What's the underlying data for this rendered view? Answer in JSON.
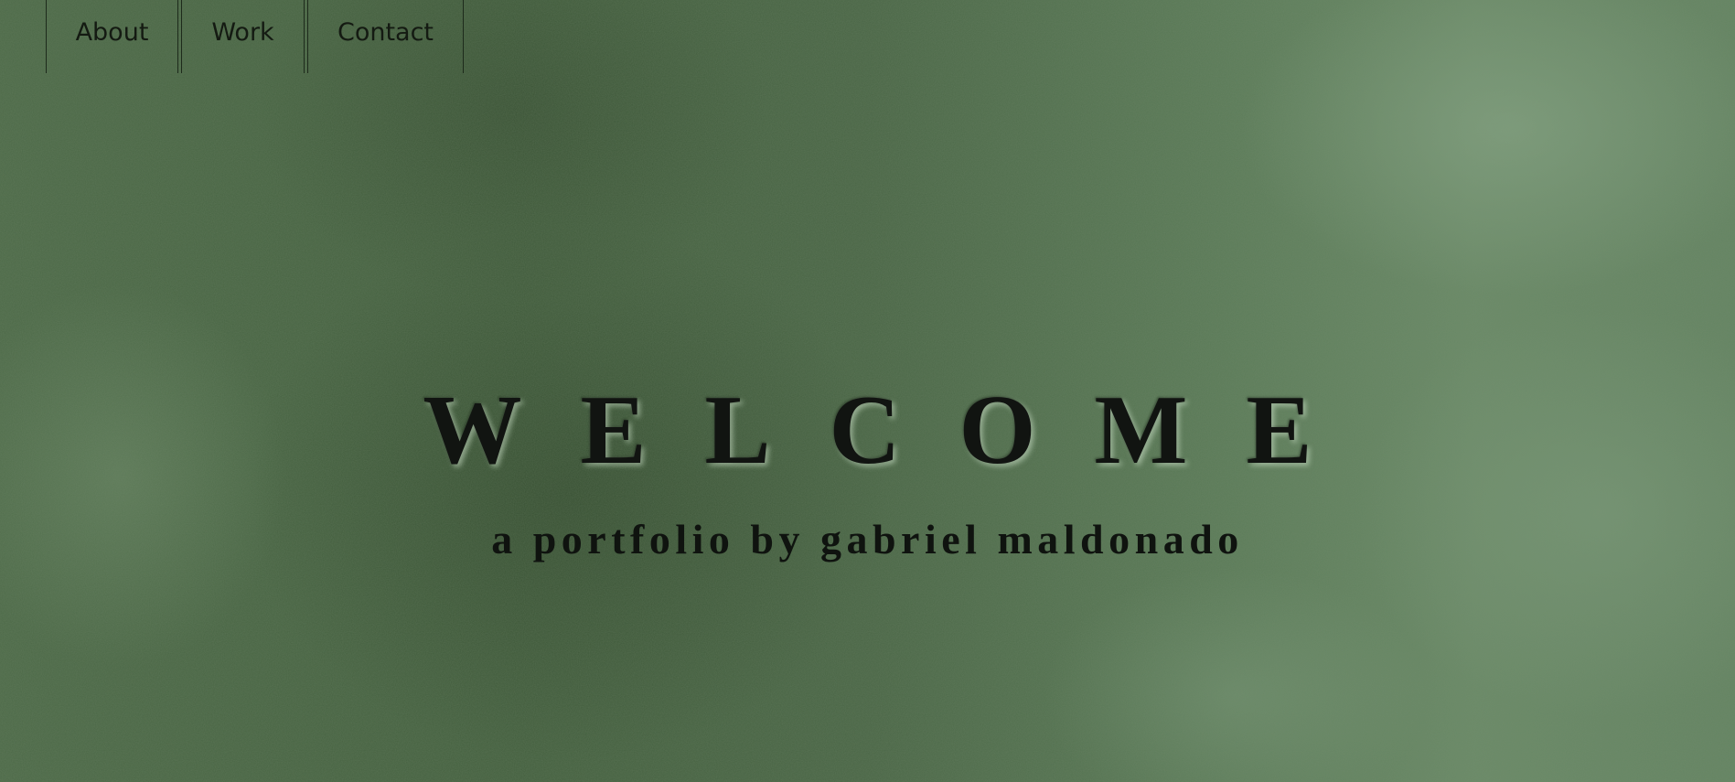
{
  "nav": {
    "items": [
      {
        "label": "About"
      },
      {
        "label": "Work"
      },
      {
        "label": "Contact"
      }
    ]
  },
  "hero": {
    "title": "WELCOME",
    "subtitle": "a portfolio by gabriel maldonado"
  },
  "colors": {
    "background": "#4f6a4c",
    "text": "#111411",
    "nav_border": "#1d2a1b"
  }
}
